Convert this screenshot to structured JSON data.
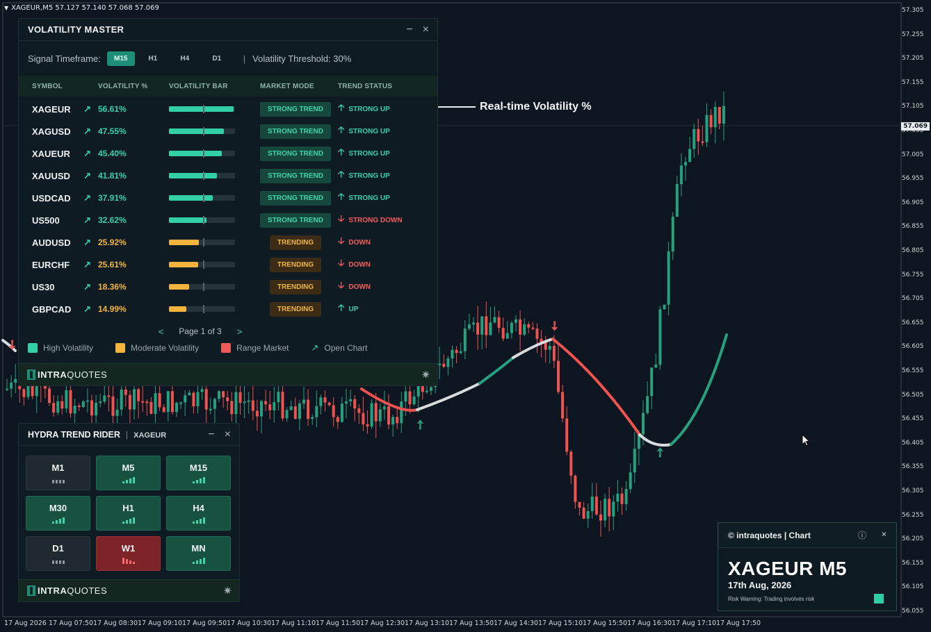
{
  "chart": {
    "symbol_line": "XAGEUR,M5  57.127 57.140 57.068 57.069",
    "annotation": "Real-time Volatility %",
    "current_price": "57.069",
    "price_axis": [
      "57.305",
      "57.255",
      "57.205",
      "57.155",
      "57.105",
      "57.055",
      "57.005",
      "56.955",
      "56.905",
      "56.855",
      "56.805",
      "56.755",
      "56.705",
      "56.655",
      "56.605",
      "56.555",
      "56.505",
      "56.455",
      "56.405",
      "56.355",
      "56.305",
      "56.255",
      "56.205",
      "56.155",
      "56.105",
      "56.055"
    ],
    "time_axis": [
      "17 Aug 2026",
      "17 Aug 07:50",
      "17 Aug 08:30",
      "17 Aug 09:10",
      "17 Aug 09:50",
      "17 Aug 10:30",
      "17 Aug 11:10",
      "17 Aug 11:50",
      "17 Aug 12:30",
      "17 Aug 13:10",
      "17 Aug 13:50",
      "17 Aug 14:30",
      "17 Aug 15:10",
      "17 Aug 15:50",
      "17 Aug 16:30",
      "17 Aug 17:10",
      "17 Aug 17:50"
    ],
    "colors": {
      "bull": "#26a17f",
      "bear": "#ef5350",
      "neutral": "#d8dcde",
      "background": "#0d1620"
    }
  },
  "volatility_master": {
    "title": "VOLATILITY MASTER",
    "minimize": "−",
    "close": "×",
    "timeframe_label": "Signal Timeframe:",
    "timeframes": [
      "M15",
      "H1",
      "H4",
      "D1"
    ],
    "active_timeframe": "M15",
    "separator": "|",
    "threshold_label": "Volatility Threshold:",
    "threshold_value": "30%",
    "headers": {
      "symbol": "SYMBOL",
      "volatility": "VOLATILITY %",
      "bar": "VOLATILITY BAR",
      "mode": "MARKET MODE",
      "trend": "TREND STATUS"
    },
    "rows": [
      {
        "symbol": "XAGEUR",
        "vol": "56.61%",
        "level": 0.98,
        "kind": "high",
        "mode": "STRONG TREND",
        "trend": "STRONG UP",
        "dir": "up"
      },
      {
        "symbol": "XAGUSD",
        "vol": "47.55%",
        "level": 0.83,
        "kind": "high",
        "mode": "STRONG TREND",
        "trend": "STRONG UP",
        "dir": "up"
      },
      {
        "symbol": "XAUEUR",
        "vol": "45.40%",
        "level": 0.8,
        "kind": "high",
        "mode": "STRONG TREND",
        "trend": "STRONG UP",
        "dir": "up"
      },
      {
        "symbol": "XAUUSD",
        "vol": "41.81%",
        "level": 0.73,
        "kind": "high",
        "mode": "STRONG TREND",
        "trend": "STRONG UP",
        "dir": "up"
      },
      {
        "symbol": "USDCAD",
        "vol": "37.91%",
        "level": 0.66,
        "kind": "high",
        "mode": "STRONG TREND",
        "trend": "STRONG UP",
        "dir": "up"
      },
      {
        "symbol": "US500",
        "vol": "32.62%",
        "level": 0.57,
        "kind": "high",
        "mode": "STRONG TREND",
        "trend": "STRONG DOWN",
        "dir": "down"
      },
      {
        "symbol": "AUDUSD",
        "vol": "25.92%",
        "level": 0.45,
        "kind": "mod",
        "mode": "TRENDING",
        "trend": "DOWN",
        "dir": "down"
      },
      {
        "symbol": "EURCHF",
        "vol": "25.61%",
        "level": 0.44,
        "kind": "mod",
        "mode": "TRENDING",
        "trend": "DOWN",
        "dir": "down"
      },
      {
        "symbol": "US30",
        "vol": "18.36%",
        "level": 0.31,
        "kind": "mod",
        "mode": "TRENDING",
        "trend": "DOWN",
        "dir": "down"
      },
      {
        "symbol": "GBPCAD",
        "vol": "14.99%",
        "level": 0.26,
        "kind": "mod",
        "mode": "TRENDING",
        "trend": "UP",
        "dir": "up"
      }
    ],
    "pager": {
      "prev": "<",
      "text": "Page 1 of 3",
      "next": ">"
    },
    "legend": {
      "high": "High Volatility",
      "moderate": "Moderate Volatility",
      "range": "Range Market",
      "open": "Open Chart"
    },
    "colors": {
      "high": "#33cfa5",
      "moderate": "#f4b53f",
      "range": "#ef5b5b"
    },
    "brand_bold": "INTRA",
    "brand_rest": "QUOTES"
  },
  "hydra": {
    "title": "HYDRA TREND RIDER",
    "separator": "|",
    "symbol": "XAGEUR",
    "minimize": "−",
    "close": "×",
    "cards": [
      {
        "tf": "M1",
        "state": "neutral"
      },
      {
        "tf": "M5",
        "state": "bull"
      },
      {
        "tf": "M15",
        "state": "bull"
      },
      {
        "tf": "M30",
        "state": "bull"
      },
      {
        "tf": "H1",
        "state": "bull"
      },
      {
        "tf": "H4",
        "state": "bull"
      },
      {
        "tf": "D1",
        "state": "neutral"
      },
      {
        "tf": "W1",
        "state": "bear"
      },
      {
        "tf": "MN",
        "state": "bull"
      }
    ],
    "brand_bold": "INTRA",
    "brand_rest": "QUOTES"
  },
  "info_card": {
    "title": "© intraquotes | Chart",
    "info": "ⓘ",
    "close": "×",
    "big": "XAGEUR M5",
    "date": "17th Aug, 2026",
    "risk": "Risk Warning: Trading involves risk"
  }
}
